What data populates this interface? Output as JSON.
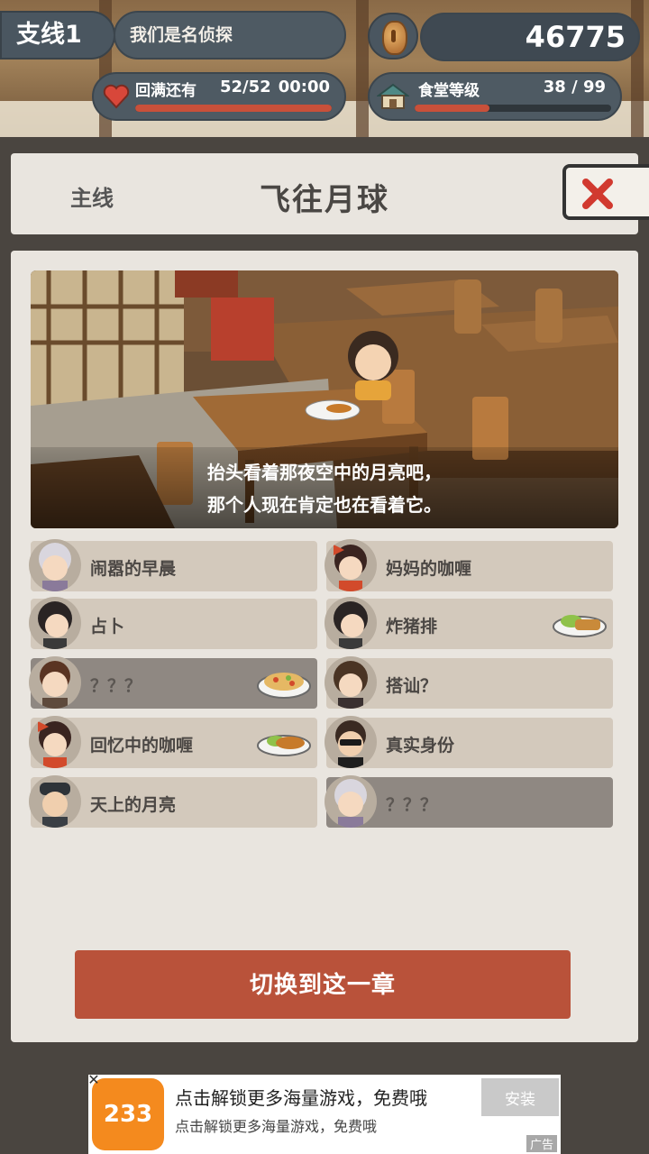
{
  "hud": {
    "branch_tag": "支线1",
    "branch_name": "我们是名侦探",
    "coins": "46775",
    "hp_label": "回满还有",
    "hp_count": "52/52",
    "hp_timer": "00:00",
    "hp_fill": 1.0,
    "canteen_label": "食堂等级",
    "canteen_level": "38 / 99",
    "canteen_fill": 0.38,
    "colors": {
      "bar_fill": "#c8503a",
      "pill_bg": "#4e5a63"
    }
  },
  "header": {
    "mainline_label": "主线",
    "chapter_title": "飞往月球",
    "close_icon": "close-x-icon"
  },
  "scene": {
    "caption_line1": "抬头看着那夜空中的月亮吧，",
    "caption_line2": "那个人现在肯定也在看着它。"
  },
  "episodes": [
    {
      "label": "闹嚣的早晨",
      "avatar": "old-woman",
      "locked": false,
      "dish": null
    },
    {
      "label": "妈妈的咖喱",
      "avatar": "girl-bow",
      "locked": false,
      "dish": null
    },
    {
      "label": "占卜",
      "avatar": "woman-dark-hair",
      "locked": false,
      "dish": null
    },
    {
      "label": "炸猪排",
      "avatar": "woman-dark-hair",
      "locked": false,
      "dish": "tonkatsu"
    },
    {
      "label": "？？？",
      "avatar": "man-brown-hair",
      "locked": true,
      "dish": "fried-rice"
    },
    {
      "label": "搭讪？",
      "avatar": "man-long-hair",
      "locked": false,
      "dish": null
    },
    {
      "label": "回忆中的咖喱",
      "avatar": "girl-bow",
      "locked": false,
      "dish": "curry-rice"
    },
    {
      "label": "真实身份",
      "avatar": "man-sunglasses",
      "locked": false,
      "dish": null
    },
    {
      "label": "天上的月亮",
      "avatar": "man-cap",
      "locked": false,
      "dish": null
    },
    {
      "label": "？？？",
      "avatar": "old-woman",
      "locked": true,
      "dish": null
    }
  ],
  "actions": {
    "switch_label": "切换到这一章"
  },
  "ad": {
    "logo_text": "233",
    "title": "点击解锁更多海量游戏，免费哦",
    "subtitle": "点击解锁更多海量游戏，免费哦",
    "install_label": "安装",
    "ad_tag": "广告"
  }
}
